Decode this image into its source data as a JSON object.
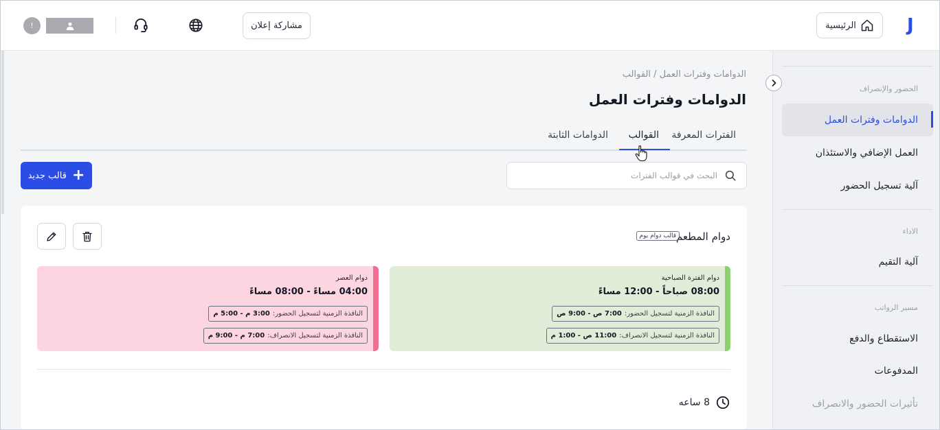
{
  "header": {
    "logo": "J",
    "home_label": "الرئيسية",
    "share_label": "مشاركة إعلان",
    "alert_badge": "!"
  },
  "sidebar": {
    "groups": [
      {
        "title": "الحضور والإنصراف",
        "items": [
          "الدوامات وفترات العمل",
          "العمل الإضافي والاستئذان",
          "آلية تسجيل الحضور"
        ]
      },
      {
        "title": "الاداء",
        "items": [
          "آلية التقيم"
        ]
      },
      {
        "title": "مسير الرواتب",
        "items": [
          "الاستقطاع والدفع",
          "المدفوعات",
          "تأثيرات الحضور والانصراف"
        ]
      }
    ],
    "active_item": "الدوامات وفترات العمل"
  },
  "breadcrumb": "الدوامات وفترات العمل / القوالب",
  "page_title": "الدوامات وفترات العمل",
  "tabs": [
    {
      "label": "الفترات المعرفة",
      "active": false
    },
    {
      "label": "القوالب",
      "active": true
    },
    {
      "label": "الدوامات الثابتة",
      "active": false
    }
  ],
  "search": {
    "placeholder": "البحث في قوالب الفترات",
    "value": ""
  },
  "new_template_label": "قالب جديد",
  "template": {
    "name": "دوام المطعم",
    "badge": "قالب دوام يوم",
    "periods": [
      {
        "name": "دوام الفترة الصباحية",
        "time": "08:00 صباحاً - 12:00 مساءً",
        "checkin_label": "النافذة الزمنية لتسجيل الحضور:",
        "checkin_value": "7:00 ص - 9:00 ص",
        "checkout_label": "النافذة الزمنية لتسجيل الانصراف:",
        "checkout_value": "11:00 ص - 1:00 م",
        "color": "#e1ecd9",
        "accent": "#8fd06e"
      },
      {
        "name": "دوام العصر",
        "time": "04:00 مساءً - 08:00 مساءً",
        "checkin_label": "النافذة الزمنية لتسجيل الحضور:",
        "checkin_value": "3:00 م - 5:00 م",
        "checkout_label": "النافذة الزمنية لتسجيل الانصراف:",
        "checkout_value": "7:00 م - 9:00 م",
        "color": "#fcd5e1",
        "accent": "#ef6f95"
      }
    ],
    "duration": "8 ساعه"
  },
  "colors": {
    "accent": "#2b4de6"
  }
}
